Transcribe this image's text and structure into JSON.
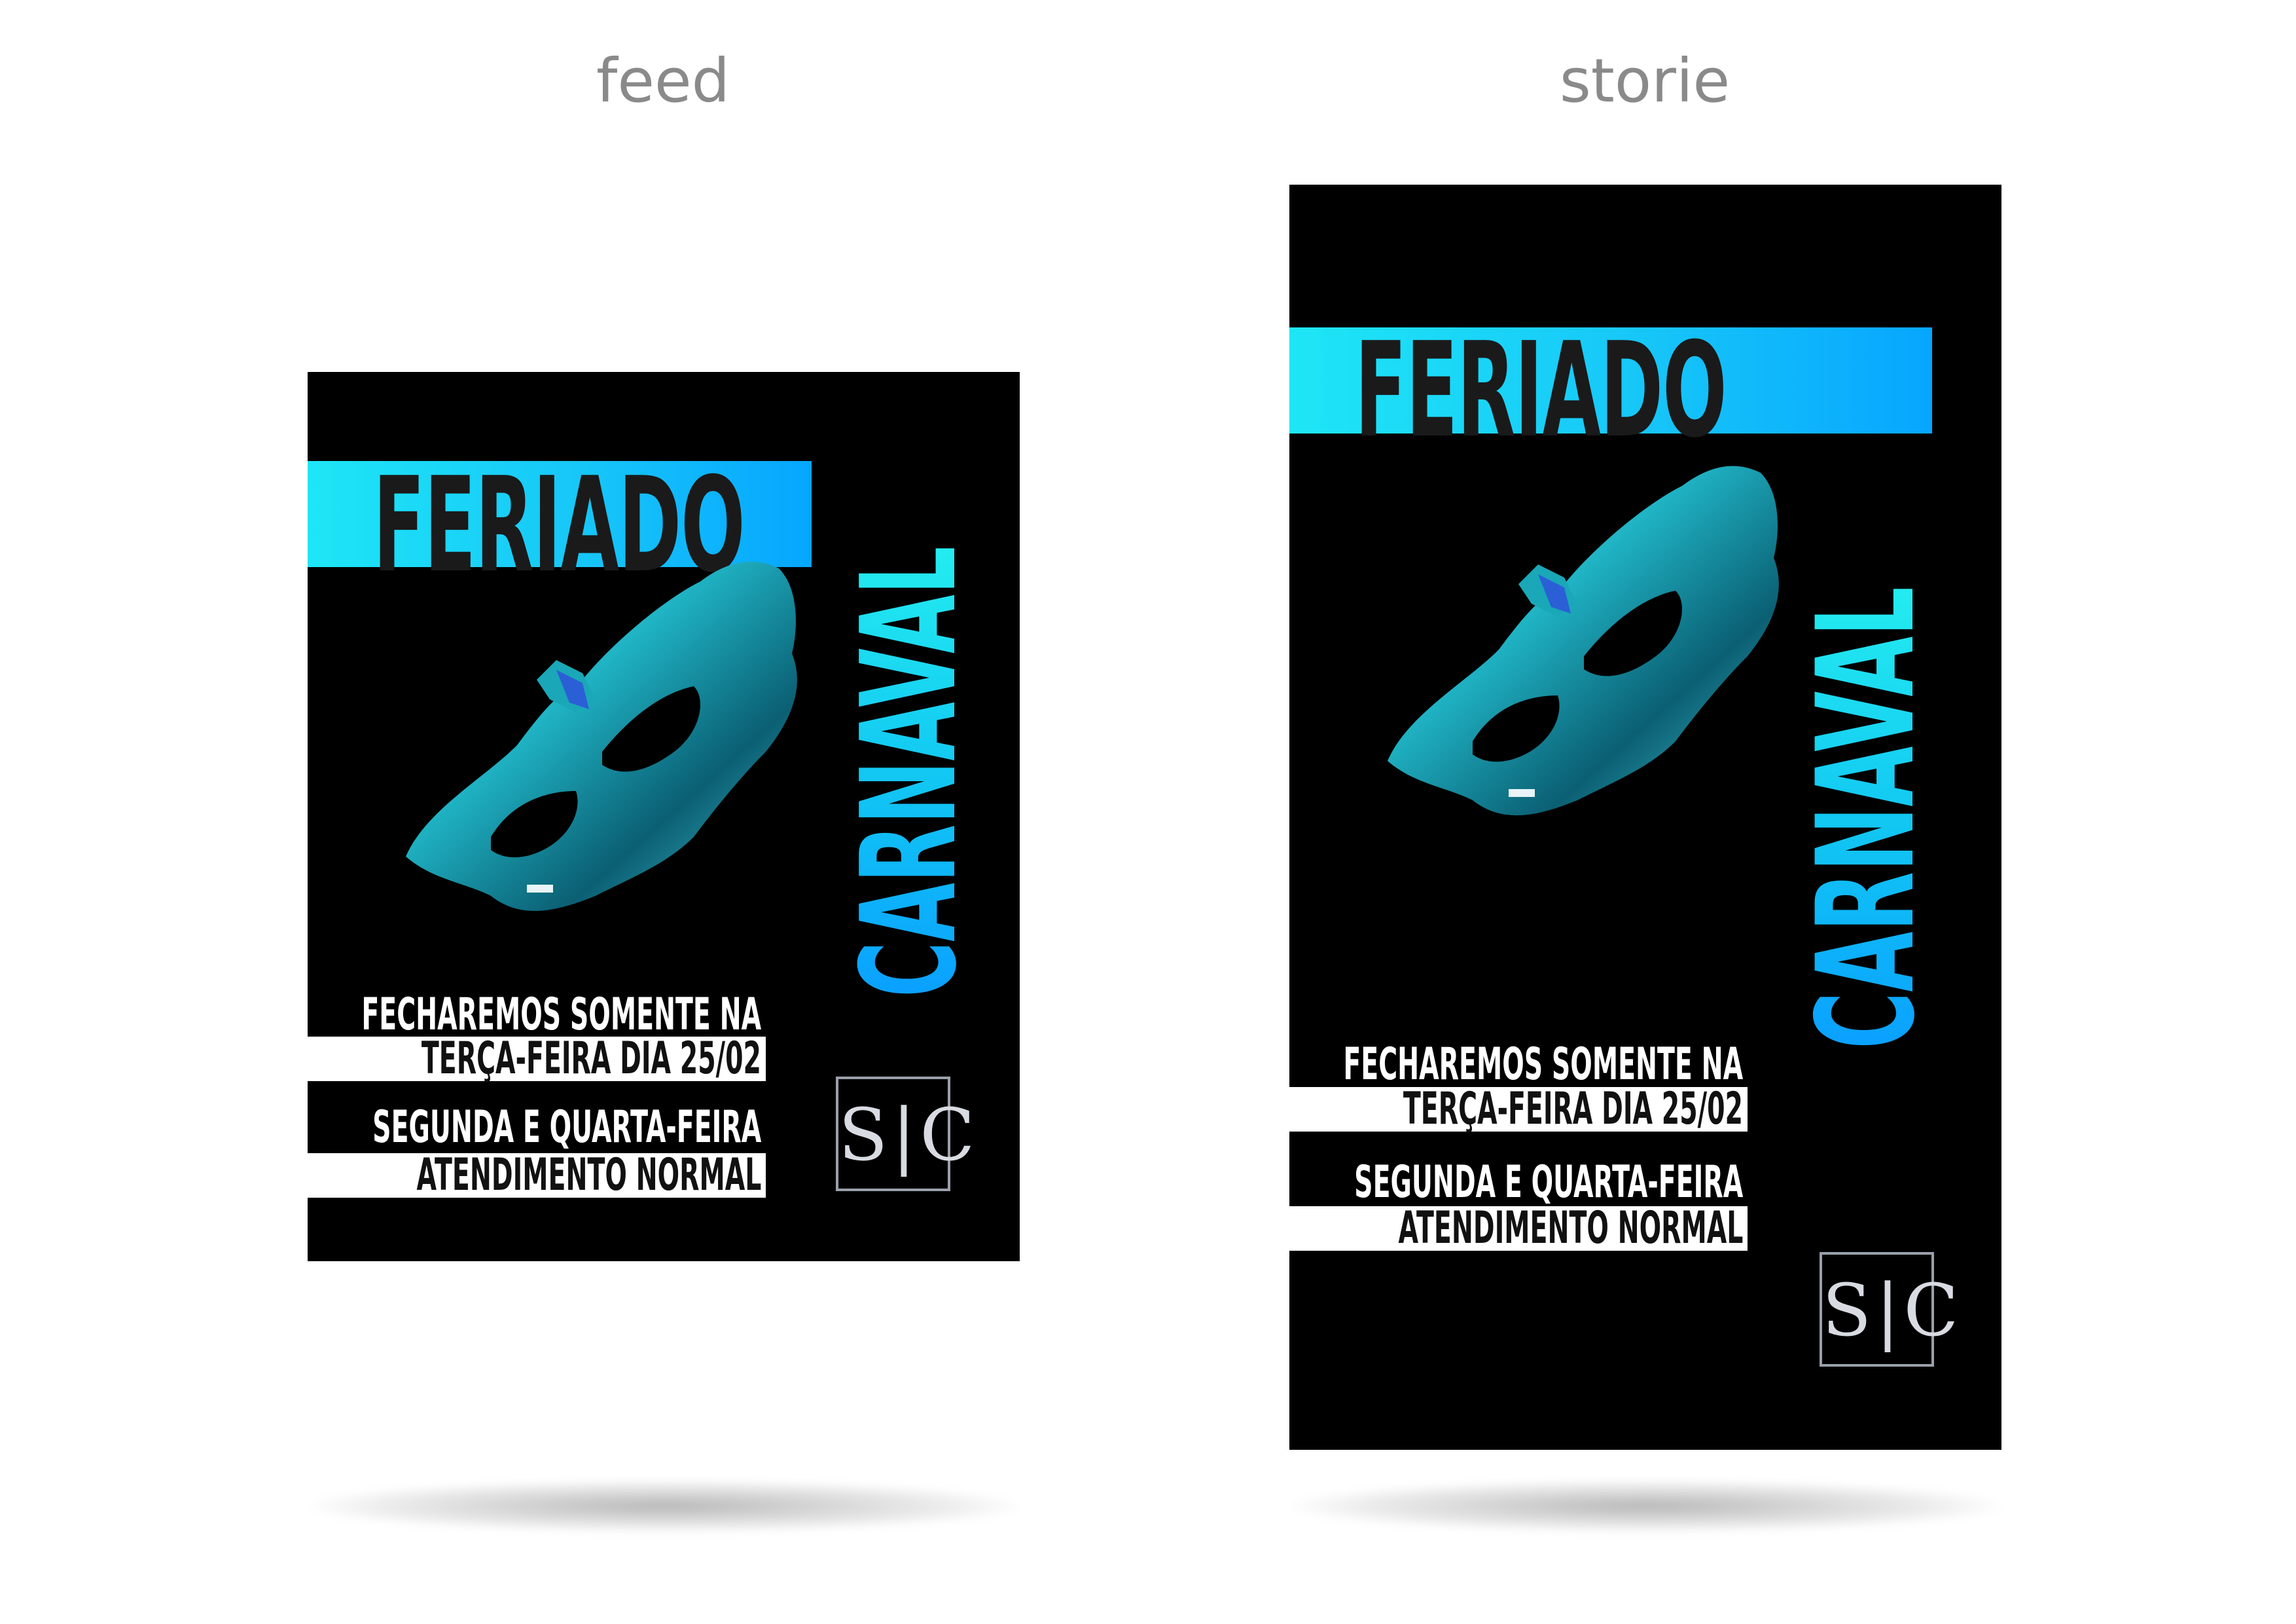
{
  "labels": {
    "feed": "feed",
    "storie": "storie"
  },
  "poster": {
    "feriado": "FERIADO",
    "carnaval": "CARNAVAL",
    "line1": "FECHAREMOS SOMENTE NA",
    "line2": "TERÇA-FEIRA DIA 25/02",
    "line3": "SEGUNDA E QUARTA-FEIRA",
    "line4": "ATENDIMENTO NORMAL",
    "logo": "S|C"
  },
  "colors": {
    "accent_cyan": "#1ee6f6",
    "accent_blue": "#06a6ff",
    "mask_teal": "#1aa7b8",
    "background": "#000000"
  },
  "icons": {
    "mask": "carnival-mask-icon",
    "logo": "sc-monogram-logo"
  }
}
